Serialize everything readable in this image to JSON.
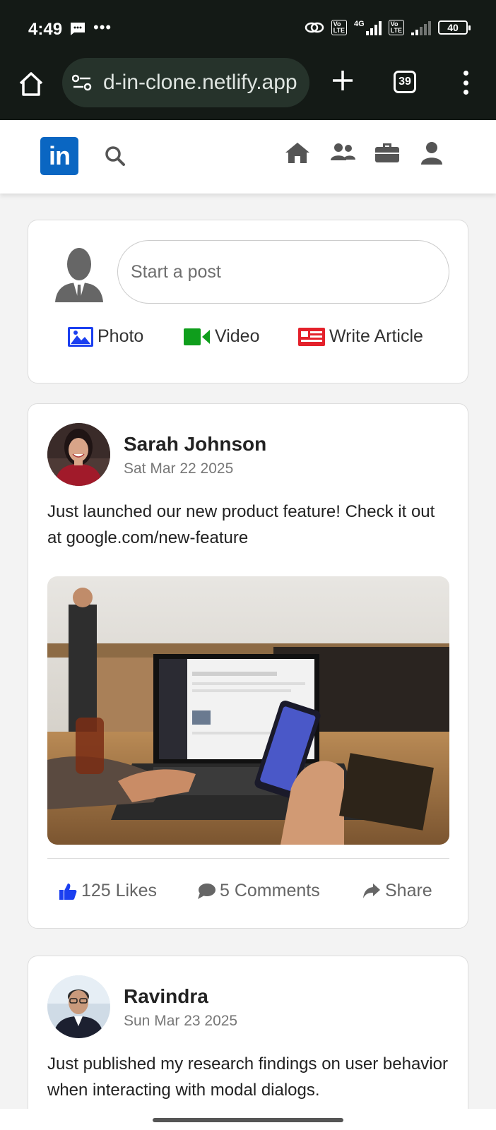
{
  "status_bar": {
    "time": "4:49",
    "network": "4G",
    "battery": "40"
  },
  "browser": {
    "url": "d-in-clone.netlify.app",
    "tab_count": "39"
  },
  "header": {
    "logo_text": "in",
    "nav_icons": [
      "home-icon",
      "network-icon",
      "jobs-icon",
      "profile-icon"
    ]
  },
  "composer": {
    "placeholder": "Start a post",
    "actions": [
      {
        "label": "Photo",
        "icon": "photo-icon",
        "color": "#1b3ff0"
      },
      {
        "label": "Video",
        "icon": "video-icon",
        "color": "#0f9e1c"
      },
      {
        "label": "Write Article",
        "icon": "article-icon",
        "color": "#e4212b"
      }
    ]
  },
  "posts": [
    {
      "author": "Sarah Johnson",
      "date": "Sat Mar 22 2025",
      "text": "Just launched our new product feature! Check it out at google.com/new-feature",
      "likes": "125 Likes",
      "comments": "5 Comments",
      "share": "Share"
    },
    {
      "author": "Ravindra",
      "date": "Sun Mar 23 2025",
      "text": "Just published my research findings on user behavior when interacting with modal dialogs."
    }
  ],
  "colors": {
    "brand": "#0a66c2",
    "like": "#1b3ff0"
  }
}
